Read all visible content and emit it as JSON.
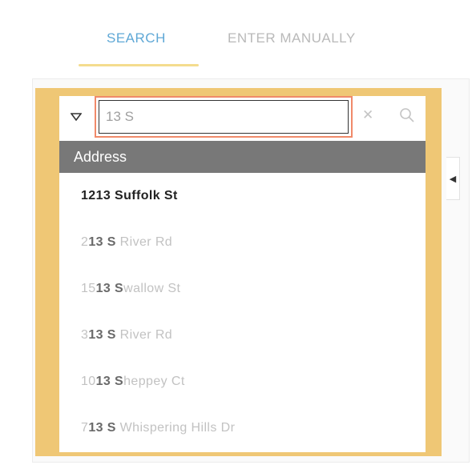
{
  "tabs": [
    {
      "label": "SEARCH",
      "active": true
    },
    {
      "label": "ENTER MANUALLY",
      "active": false
    }
  ],
  "search": {
    "value": "13 S",
    "placeholder": ""
  },
  "results_header": "Address",
  "results": [
    {
      "pre": "12",
      "match": "13 S",
      "post": "uffolk St"
    },
    {
      "pre": "2",
      "match": "13 S",
      "post": " River Rd"
    },
    {
      "pre": "15",
      "match": "13 S",
      "post": "wallow St"
    },
    {
      "pre": "3",
      "match": "13 S",
      "post": " River Rd"
    },
    {
      "pre": "10",
      "match": "13 S",
      "post": "heppey Ct"
    },
    {
      "pre": "7",
      "match": "13 S",
      "post": " Whispering Hills Dr"
    }
  ],
  "icons": {
    "dropdown": "caret-down-icon",
    "clear": "close-icon",
    "search": "search-icon",
    "side_tab": "caret-left-icon"
  },
  "colors": {
    "active_tab": "#5fa8d6",
    "tab_underline": "#f4dc8e",
    "card_background": "#efc775",
    "input_focus_border": "#f08a6a",
    "header_bar": "#787878"
  }
}
